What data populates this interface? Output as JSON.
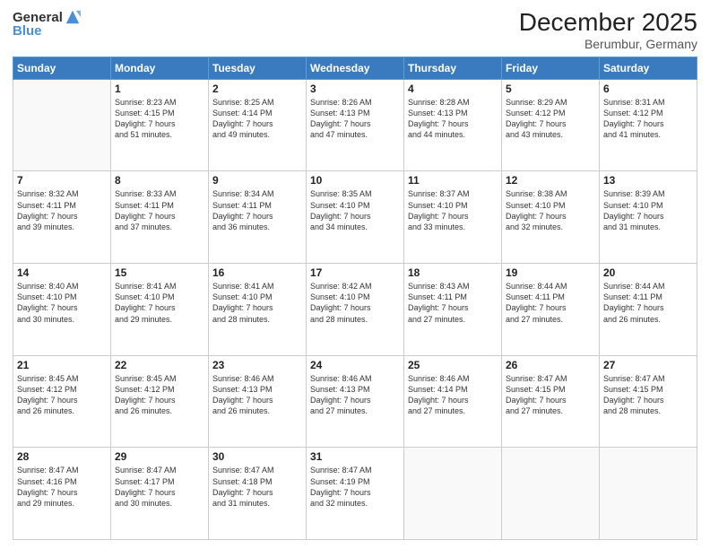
{
  "header": {
    "logo_general": "General",
    "logo_blue": "Blue",
    "month_title": "December 2025",
    "location": "Berumbur, Germany"
  },
  "weekdays": [
    "Sunday",
    "Monday",
    "Tuesday",
    "Wednesday",
    "Thursday",
    "Friday",
    "Saturday"
  ],
  "weeks": [
    [
      {
        "day": "",
        "info": ""
      },
      {
        "day": "1",
        "info": "Sunrise: 8:23 AM\nSunset: 4:15 PM\nDaylight: 7 hours\nand 51 minutes."
      },
      {
        "day": "2",
        "info": "Sunrise: 8:25 AM\nSunset: 4:14 PM\nDaylight: 7 hours\nand 49 minutes."
      },
      {
        "day": "3",
        "info": "Sunrise: 8:26 AM\nSunset: 4:13 PM\nDaylight: 7 hours\nand 47 minutes."
      },
      {
        "day": "4",
        "info": "Sunrise: 8:28 AM\nSunset: 4:13 PM\nDaylight: 7 hours\nand 44 minutes."
      },
      {
        "day": "5",
        "info": "Sunrise: 8:29 AM\nSunset: 4:12 PM\nDaylight: 7 hours\nand 43 minutes."
      },
      {
        "day": "6",
        "info": "Sunrise: 8:31 AM\nSunset: 4:12 PM\nDaylight: 7 hours\nand 41 minutes."
      }
    ],
    [
      {
        "day": "7",
        "info": "Sunrise: 8:32 AM\nSunset: 4:11 PM\nDaylight: 7 hours\nand 39 minutes."
      },
      {
        "day": "8",
        "info": "Sunrise: 8:33 AM\nSunset: 4:11 PM\nDaylight: 7 hours\nand 37 minutes."
      },
      {
        "day": "9",
        "info": "Sunrise: 8:34 AM\nSunset: 4:11 PM\nDaylight: 7 hours\nand 36 minutes."
      },
      {
        "day": "10",
        "info": "Sunrise: 8:35 AM\nSunset: 4:10 PM\nDaylight: 7 hours\nand 34 minutes."
      },
      {
        "day": "11",
        "info": "Sunrise: 8:37 AM\nSunset: 4:10 PM\nDaylight: 7 hours\nand 33 minutes."
      },
      {
        "day": "12",
        "info": "Sunrise: 8:38 AM\nSunset: 4:10 PM\nDaylight: 7 hours\nand 32 minutes."
      },
      {
        "day": "13",
        "info": "Sunrise: 8:39 AM\nSunset: 4:10 PM\nDaylight: 7 hours\nand 31 minutes."
      }
    ],
    [
      {
        "day": "14",
        "info": "Sunrise: 8:40 AM\nSunset: 4:10 PM\nDaylight: 7 hours\nand 30 minutes."
      },
      {
        "day": "15",
        "info": "Sunrise: 8:41 AM\nSunset: 4:10 PM\nDaylight: 7 hours\nand 29 minutes."
      },
      {
        "day": "16",
        "info": "Sunrise: 8:41 AM\nSunset: 4:10 PM\nDaylight: 7 hours\nand 28 minutes."
      },
      {
        "day": "17",
        "info": "Sunrise: 8:42 AM\nSunset: 4:10 PM\nDaylight: 7 hours\nand 28 minutes."
      },
      {
        "day": "18",
        "info": "Sunrise: 8:43 AM\nSunset: 4:11 PM\nDaylight: 7 hours\nand 27 minutes."
      },
      {
        "day": "19",
        "info": "Sunrise: 8:44 AM\nSunset: 4:11 PM\nDaylight: 7 hours\nand 27 minutes."
      },
      {
        "day": "20",
        "info": "Sunrise: 8:44 AM\nSunset: 4:11 PM\nDaylight: 7 hours\nand 26 minutes."
      }
    ],
    [
      {
        "day": "21",
        "info": "Sunrise: 8:45 AM\nSunset: 4:12 PM\nDaylight: 7 hours\nand 26 minutes."
      },
      {
        "day": "22",
        "info": "Sunrise: 8:45 AM\nSunset: 4:12 PM\nDaylight: 7 hours\nand 26 minutes."
      },
      {
        "day": "23",
        "info": "Sunrise: 8:46 AM\nSunset: 4:13 PM\nDaylight: 7 hours\nand 26 minutes."
      },
      {
        "day": "24",
        "info": "Sunrise: 8:46 AM\nSunset: 4:13 PM\nDaylight: 7 hours\nand 27 minutes."
      },
      {
        "day": "25",
        "info": "Sunrise: 8:46 AM\nSunset: 4:14 PM\nDaylight: 7 hours\nand 27 minutes."
      },
      {
        "day": "26",
        "info": "Sunrise: 8:47 AM\nSunset: 4:15 PM\nDaylight: 7 hours\nand 27 minutes."
      },
      {
        "day": "27",
        "info": "Sunrise: 8:47 AM\nSunset: 4:15 PM\nDaylight: 7 hours\nand 28 minutes."
      }
    ],
    [
      {
        "day": "28",
        "info": "Sunrise: 8:47 AM\nSunset: 4:16 PM\nDaylight: 7 hours\nand 29 minutes."
      },
      {
        "day": "29",
        "info": "Sunrise: 8:47 AM\nSunset: 4:17 PM\nDaylight: 7 hours\nand 30 minutes."
      },
      {
        "day": "30",
        "info": "Sunrise: 8:47 AM\nSunset: 4:18 PM\nDaylight: 7 hours\nand 31 minutes."
      },
      {
        "day": "31",
        "info": "Sunrise: 8:47 AM\nSunset: 4:19 PM\nDaylight: 7 hours\nand 32 minutes."
      },
      {
        "day": "",
        "info": ""
      },
      {
        "day": "",
        "info": ""
      },
      {
        "day": "",
        "info": ""
      }
    ]
  ]
}
